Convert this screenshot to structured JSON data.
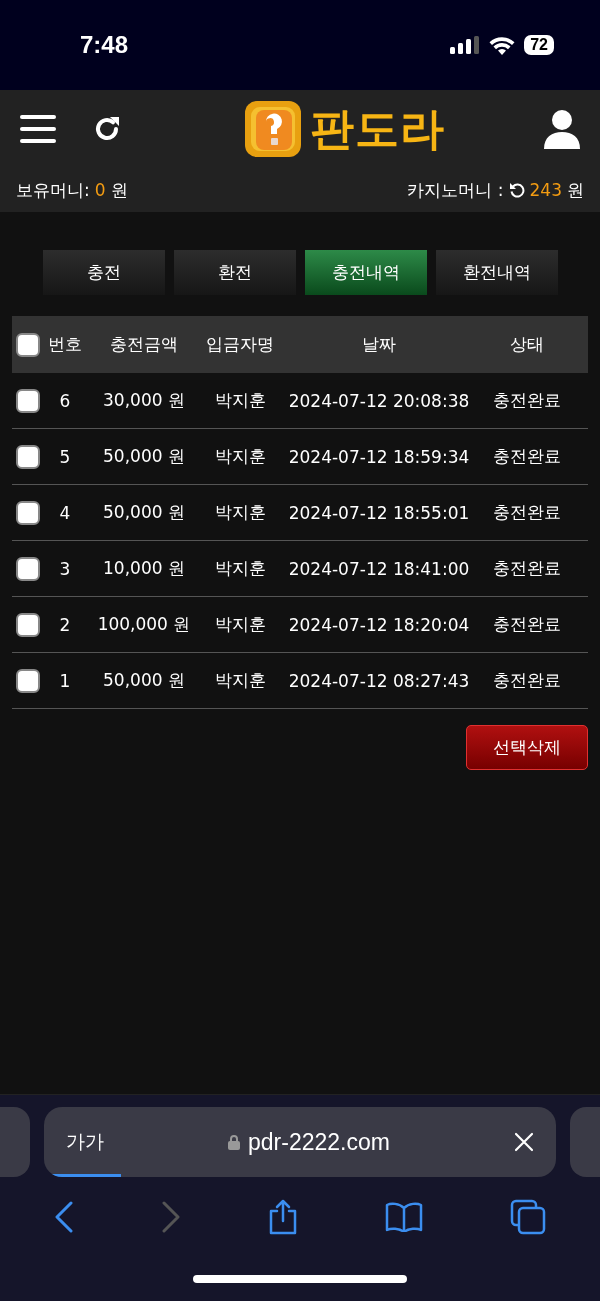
{
  "status_bar": {
    "time": "7:48",
    "battery": "72"
  },
  "header": {
    "logo": "판도라"
  },
  "balances": {
    "wallet_label": "보유머니:",
    "wallet_value": "0",
    "wallet_unit": "원",
    "casino_label": "카지노머니 :",
    "casino_value": "243",
    "casino_unit": "원"
  },
  "tabs": [
    {
      "label": "충전",
      "selected": false
    },
    {
      "label": "환전",
      "selected": false
    },
    {
      "label": "충전내역",
      "selected": true
    },
    {
      "label": "환전내역",
      "selected": false
    }
  ],
  "table": {
    "select_all_checked": false,
    "columns": [
      "번호",
      "충전금액",
      "입금자명",
      "날짜",
      "상태"
    ],
    "rows": [
      {
        "checked": false,
        "cells": [
          "6",
          "30,000 원",
          "박지훈",
          "2024-07-12 20:08:38",
          "충전완료"
        ]
      },
      {
        "checked": false,
        "cells": [
          "5",
          "50,000 원",
          "박지훈",
          "2024-07-12 18:59:34",
          "충전완료"
        ]
      },
      {
        "checked": false,
        "cells": [
          "4",
          "50,000 원",
          "박지훈",
          "2024-07-12 18:55:01",
          "충전완료"
        ]
      },
      {
        "checked": false,
        "cells": [
          "3",
          "10,000 원",
          "박지훈",
          "2024-07-12 18:41:00",
          "충전완료"
        ]
      },
      {
        "checked": false,
        "cells": [
          "2",
          "100,000 원",
          "박지훈",
          "2024-07-12 18:20:04",
          "충전완료"
        ]
      },
      {
        "checked": false,
        "cells": [
          "1",
          "50,000 원",
          "박지훈",
          "2024-07-12 08:27:43",
          "충전완료"
        ]
      }
    ]
  },
  "delete_button": "선택삭제",
  "browser": {
    "text_size": "가가",
    "url": "pdr-2222.com",
    "level": 0.15
  }
}
